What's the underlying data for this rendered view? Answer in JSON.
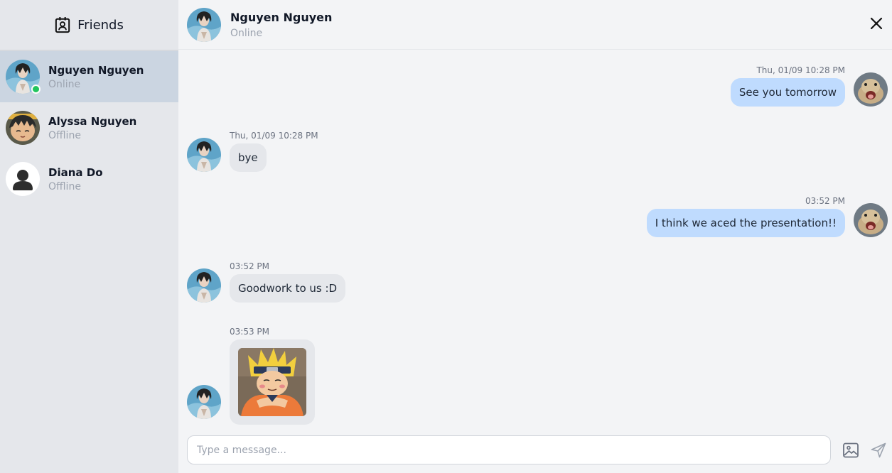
{
  "sidebar": {
    "title": "Friends",
    "title_icon": "contact-card-icon",
    "friends": [
      {
        "name": "Nguyen Nguyen",
        "status": "Online",
        "avatar": "dark-hair-avatar",
        "active": true
      },
      {
        "name": "Alyssa Nguyen",
        "status": "Offline",
        "avatar": "cartoon-boy-avatar"
      },
      {
        "name": "Diana Do",
        "status": "Offline",
        "avatar": "default-user-avatar"
      }
    ]
  },
  "chat": {
    "header": {
      "name": "Nguyen Nguyen",
      "status": "Online",
      "close_icon": "close-icon"
    },
    "messages": [
      {
        "from": "me",
        "time": "Thu, 01/09   10:28 PM",
        "text": "See you tomorrow"
      },
      {
        "from": "them",
        "time": "Thu, 01/09   10:28 PM",
        "text": "bye"
      },
      {
        "from": "me",
        "time": "03:52 PM",
        "text": "I think we aced the presentation!!"
      },
      {
        "from": "them",
        "time": "03:52 PM",
        "text": "Goodwork to us :D"
      },
      {
        "from": "them",
        "time": "03:53 PM",
        "image": "naruto-sticker"
      }
    ],
    "composer": {
      "placeholder": "Type a message...",
      "value": "",
      "image_icon": "image-icon",
      "send_icon": "send-icon"
    }
  },
  "colors": {
    "sidebar_bg": "#e5e7eb",
    "active_friend_bg": "#cbd5e1",
    "chat_bg": "#f3f4f6",
    "my_bubble": "#bfdbfe",
    "their_bubble": "#e5e7eb",
    "online_dot": "#22c55e"
  }
}
